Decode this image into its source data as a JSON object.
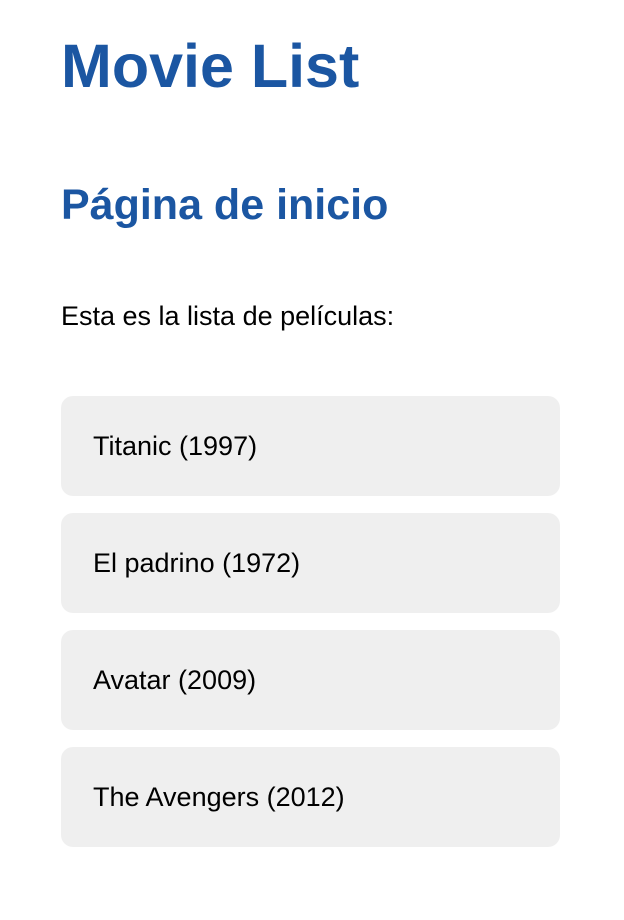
{
  "header": {
    "title": "Movie List"
  },
  "main": {
    "subtitle": "Página de inicio",
    "intro": "Esta es la lista de películas:",
    "movies": [
      {
        "label": "Titanic (1997)"
      },
      {
        "label": "El padrino (1972)"
      },
      {
        "label": "Avatar (2009)"
      },
      {
        "label": "The Avengers (2012)"
      }
    ]
  },
  "colors": {
    "heading": "#1b56a2",
    "card_bg": "#efefef"
  }
}
